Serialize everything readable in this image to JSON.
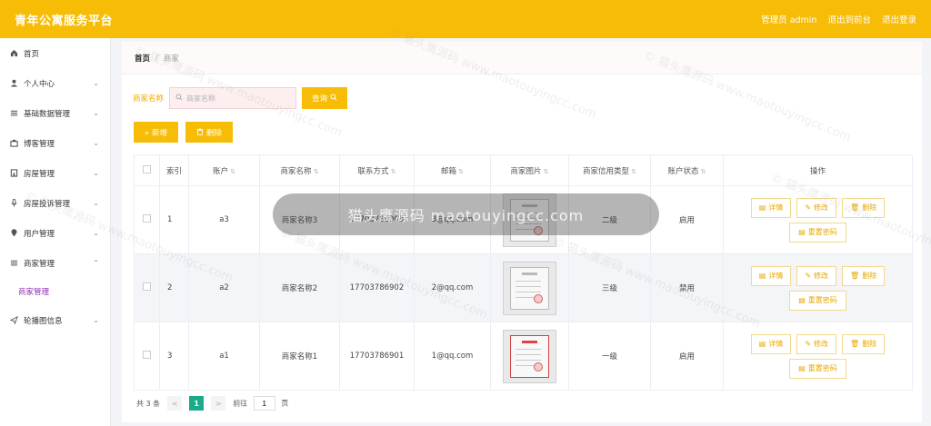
{
  "app": {
    "title": "青年公寓服务平台",
    "user_label": "管理员 admin",
    "exit_backend": "退出到前台",
    "logout": "退出登录"
  },
  "sidebar": {
    "items": [
      {
        "label": "首页",
        "icon": "home-icon",
        "chevron": ""
      },
      {
        "label": "个人中心",
        "icon": "user-icon",
        "chevron": "⌄"
      },
      {
        "label": "基础数据管理",
        "icon": "list-icon",
        "chevron": "⌄"
      },
      {
        "label": "博客管理",
        "icon": "blog-icon",
        "chevron": "⌄"
      },
      {
        "label": "房屋管理",
        "icon": "house-icon",
        "chevron": "⌄"
      },
      {
        "label": "房屋投诉管理",
        "icon": "mic-icon",
        "chevron": "⌄"
      },
      {
        "label": "用户管理",
        "icon": "location-icon",
        "chevron": "⌄"
      },
      {
        "label": "商家管理",
        "icon": "menu-icon",
        "chevron": "⌃"
      }
    ],
    "submenu_active": "商家管理",
    "last_item": {
      "label": "轮播图信息",
      "icon": "send-icon",
      "chevron": "⌄"
    }
  },
  "breadcrumb": {
    "home": "首页",
    "sep": "/",
    "current": "商家"
  },
  "search": {
    "label": "商家名称",
    "placeholder": "商家名称",
    "value": "",
    "button": "查询"
  },
  "actions": {
    "add": "新增",
    "delete": "删除"
  },
  "table": {
    "headers": [
      "索引",
      "账户",
      "商家名称",
      "联系方式",
      "邮箱",
      "商家图片",
      "商家信用类型",
      "账户状态",
      "操作"
    ],
    "rows": [
      {
        "index": "1",
        "account": "a3",
        "name": "商家名称3",
        "phone": "17703786903",
        "email": "3@qq.com",
        "credit": "二级",
        "status": "启用"
      },
      {
        "index": "2",
        "account": "a2",
        "name": "商家名称2",
        "phone": "17703786902",
        "email": "2@qq.com",
        "credit": "三级",
        "status": "禁用"
      },
      {
        "index": "3",
        "account": "a1",
        "name": "商家名称1",
        "phone": "17703786901",
        "email": "1@qq.com",
        "credit": "一级",
        "status": "启用"
      }
    ],
    "ops": {
      "detail": "详情",
      "edit": "修改",
      "delete": "删除",
      "reset": "重置密码"
    }
  },
  "pager": {
    "total": "共 3 条",
    "prev": "<",
    "current": "1",
    "next": ">",
    "goto": "前往",
    "goto_value": "1",
    "page_unit": "页"
  },
  "overlay": {
    "text": "猫头鹰源码 maotouyingcc.com"
  },
  "watermark": {
    "text": "© 猫头鹰源码 www.maotouyingcc.com"
  },
  "colors": {
    "accent": "#f7bd06",
    "active_submenu": "#8e2fb1",
    "pager_active": "#1bab8a"
  }
}
